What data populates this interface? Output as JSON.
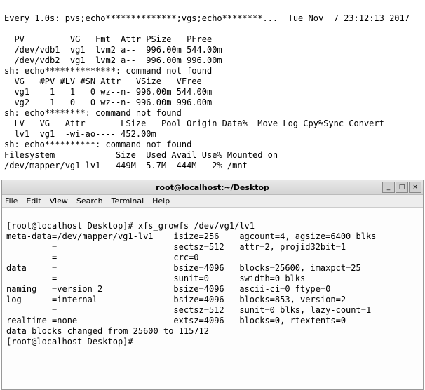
{
  "top": {
    "header_left": "Every 1.0s: pvs;echo**************;vgs;echo********...",
    "header_right": "Tue Nov  7 23:12:13 2017",
    "lines": [
      "",
      "  PV         VG   Fmt  Attr PSize   PFree",
      "  /dev/vdb1  vg1  lvm2 a--  996.00m 544.00m",
      "  /dev/vdb2  vg1  lvm2 a--  996.00m 996.00m",
      "sh: echo**************: command not found",
      "  VG   #PV #LV #SN Attr   VSize   VFree",
      "  vg1    1   1   0 wz--n- 996.00m 544.00m",
      "  vg2    1   0   0 wz--n- 996.00m 996.00m",
      "sh: echo********: command not found",
      "  LV   VG   Attr       LSize   Pool Origin Data%  Move Log Cpy%Sync Convert",
      "  lv1  vg1  -wi-ao---- 452.00m",
      "sh: echo**********: command not found",
      "Filesystem            Size  Used Avail Use% Mounted on",
      "/dev/mapper/vg1-lv1   449M  5.7M  444M   2% /mnt"
    ]
  },
  "window": {
    "title": "root@localhost:~/Desktop",
    "menu": [
      "File",
      "Edit",
      "View",
      "Search",
      "Terminal",
      "Help"
    ],
    "lines": [
      "[root@localhost Desktop]# xfs_growfs /dev/vg1/lv1",
      "meta-data=/dev/mapper/vg1-lv1    isize=256    agcount=4, agsize=6400 blks",
      "         =                       sectsz=512   attr=2, projid32bit=1",
      "         =                       crc=0",
      "data     =                       bsize=4096   blocks=25600, imaxpct=25",
      "         =                       sunit=0      swidth=0 blks",
      "naming   =version 2              bsize=4096   ascii-ci=0 ftype=0",
      "log      =internal               bsize=4096   blocks=853, version=2",
      "         =                       sectsz=512   sunit=0 blks, lazy-count=1",
      "realtime =none                   extsz=4096   blocks=0, rtextents=0",
      "data blocks changed from 25600 to 115712",
      "[root@localhost Desktop]#"
    ]
  },
  "icons": {
    "minimize": "_",
    "maximize": "□",
    "close": "×"
  }
}
